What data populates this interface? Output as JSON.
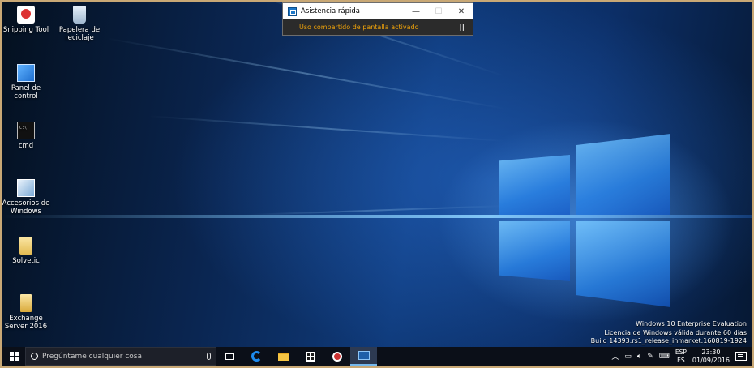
{
  "desktop": {
    "icons": [
      {
        "label": "Snipping Tool",
        "icon": "snipping-tool-icon"
      },
      {
        "label": "Papelera de reciclaje",
        "icon": "recycle-bin-icon"
      },
      {
        "label": "Panel de control",
        "icon": "control-panel-icon"
      },
      {
        "label": "cmd",
        "icon": "cmd-icon"
      },
      {
        "label": "Accesorios de Windows",
        "icon": "accessories-icon"
      },
      {
        "label": "Solvetic",
        "icon": "folder-icon"
      },
      {
        "label": "Exchange Server 2016",
        "icon": "document-icon"
      }
    ],
    "watermark": {
      "line1": "Windows 10 Enterprise Evaluation",
      "line2": "Licencia de Windows válida durante 60 días",
      "line3": "Build 14393.rs1_release_inmarket.160819-1924"
    }
  },
  "quick_assist": {
    "title": "Asistencia rápida",
    "minimize": "—",
    "maximize": "☐",
    "close": "✕",
    "status": "Uso compartido de pantalla activado",
    "pause": "||"
  },
  "taskbar": {
    "search_placeholder": "Pregúntame cualquier cosa",
    "tray": {
      "lang_top": "ESP",
      "lang_bottom": "ES",
      "time": "23:30",
      "date": "01/09/2016"
    }
  }
}
